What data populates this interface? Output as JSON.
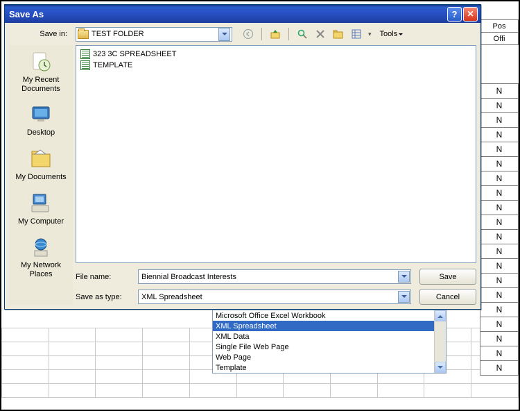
{
  "window": {
    "title": "Save As"
  },
  "savein": {
    "label": "Save in:",
    "folder": "TEST FOLDER"
  },
  "toolbar": {
    "tools_label": "Tools"
  },
  "places": {
    "recent": "My Recent Documents",
    "desktop": "Desktop",
    "mydocs": "My Documents",
    "mycomp": "My Computer",
    "network": "My Network Places"
  },
  "files": [
    "323 3C SPREADSHEET",
    "TEMPLATE"
  ],
  "filename": {
    "label": "File name:",
    "value": "Biennial Broadcast Interests"
  },
  "filetype": {
    "label": "Save as type:",
    "value": "XML Spreadsheet",
    "options": [
      "Microsoft Office Excel Workbook",
      "XML Spreadsheet",
      "XML Data",
      "Single File Web Page",
      "Web Page",
      "Template"
    ],
    "selected_index": 1
  },
  "buttons": {
    "save": "Save",
    "cancel": "Cancel"
  },
  "bg": {
    "headers": {
      "pos": "Pos",
      "offi": "Offi"
    },
    "n": "N"
  }
}
